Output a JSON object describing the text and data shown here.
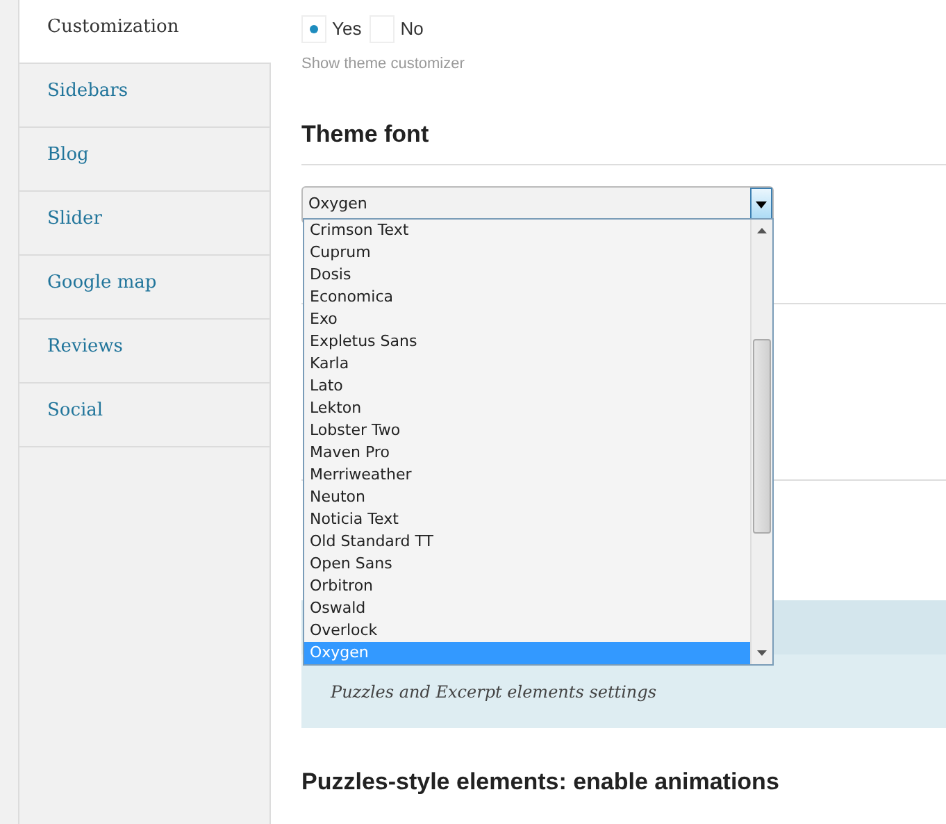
{
  "sidebar": {
    "items": [
      {
        "label": "Customization",
        "selected": true
      },
      {
        "label": "Sidebars",
        "selected": false
      },
      {
        "label": "Blog",
        "selected": false
      },
      {
        "label": "Slider",
        "selected": false
      },
      {
        "label": "Google map",
        "selected": false
      },
      {
        "label": "Reviews",
        "selected": false
      },
      {
        "label": "Social",
        "selected": false
      }
    ]
  },
  "customizer": {
    "options": [
      {
        "label": "Yes",
        "selected": true
      },
      {
        "label": "No",
        "selected": false
      }
    ],
    "help": "Show theme customizer"
  },
  "theme_font": {
    "heading": "Theme font",
    "value": "Oxygen",
    "options": [
      {
        "label": "Crimson Text",
        "selected": false
      },
      {
        "label": "Cuprum",
        "selected": false
      },
      {
        "label": "Dosis",
        "selected": false
      },
      {
        "label": "Economica",
        "selected": false
      },
      {
        "label": "Exo",
        "selected": false
      },
      {
        "label": "Expletus Sans",
        "selected": false
      },
      {
        "label": "Karla",
        "selected": false
      },
      {
        "label": "Lato",
        "selected": false
      },
      {
        "label": "Lekton",
        "selected": false
      },
      {
        "label": "Lobster Two",
        "selected": false
      },
      {
        "label": "Maven Pro",
        "selected": false
      },
      {
        "label": "Merriweather",
        "selected": false
      },
      {
        "label": "Neuton",
        "selected": false
      },
      {
        "label": "Noticia Text",
        "selected": false
      },
      {
        "label": "Old Standard TT",
        "selected": false
      },
      {
        "label": "Open Sans",
        "selected": false
      },
      {
        "label": "Orbitron",
        "selected": false
      },
      {
        "label": "Oswald",
        "selected": false
      },
      {
        "label": "Overlock",
        "selected": false
      },
      {
        "label": "Oxygen",
        "selected": true
      }
    ]
  },
  "info_band": {
    "text": "Puzzles and Excerpt elements settings"
  },
  "next_heading": "Puzzles-style elements: enable animations"
}
